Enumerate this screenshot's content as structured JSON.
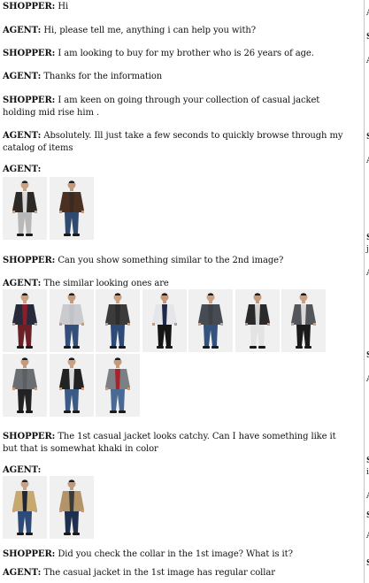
{
  "messages": [
    {
      "speaker": "SHOPPER:",
      "text": " Hi"
    },
    {
      "speaker": "AGENT:",
      "text": " Hi, please tell me, anything i can help you with?"
    },
    {
      "speaker": "SHOPPER:",
      "text": " I am looking to buy for my brother who is 26 years of age."
    },
    {
      "speaker": "AGENT:",
      "text": " Thanks for the information"
    },
    {
      "speaker": "SHOPPER:",
      "text": " I am keen on going through your collection of casual jacket holding mid rise him ."
    },
    {
      "speaker": "AGENT:",
      "text": " Absolutely. Ill just take a few seconds to quickly browse through my catalog of items"
    },
    {
      "speaker": "AGENT:",
      "text": ""
    },
    {
      "speaker": "SHOPPER:",
      "text": " Can you show something similar to the 2nd image?"
    },
    {
      "speaker": "AGENT:",
      "text": " The similar looking ones are"
    },
    {
      "speaker": "SHOPPER:",
      "text": " The 1st casual jacket looks catchy. Can I have something like it but that is somewhat khaki in color"
    },
    {
      "speaker": "AGENT:",
      "text": ""
    },
    {
      "speaker": "SHOPPER:",
      "text": " Did you check the collar in the 1st image? What is it?"
    },
    {
      "speaker": "AGENT:",
      "text": " The casual jacket in the 1st image has regular collar"
    }
  ],
  "image_sets": [
    [
      {
        "jacket": "#2d2a26",
        "inner": "#d8d8d8",
        "pants": "#b8b8b8",
        "skin": "#c9a184"
      },
      {
        "jacket": "#4a3021",
        "inner": "#3a2a22",
        "pants": "#2f4a6e",
        "skin": "#c49a7c"
      }
    ],
    [
      {
        "jacket": "#262a3a",
        "inner": "#8a1f2b",
        "pants": "#6b1f26",
        "skin": "#c9a184"
      },
      {
        "jacket": "#c9cbcf",
        "inner": "#bfc2c6",
        "pants": "#34507a",
        "skin": "#c49a7c"
      },
      {
        "jacket": "#3b3b3b",
        "inner": "#2d2d2d",
        "pants": "#2d4b78",
        "skin": "#c9a184"
      },
      {
        "jacket": "#e4e6ea",
        "inner": "#1f2a4a",
        "pants": "#151515",
        "skin": "#c49a7c"
      },
      {
        "jacket": "#474c54",
        "inner": "#3d4249",
        "pants": "#33527e",
        "skin": "#c9a184"
      },
      {
        "jacket": "#2a2a2a",
        "inner": "#d3d3d3",
        "pants": "#e3e3e3",
        "skin": "#c49a7c"
      },
      {
        "jacket": "#53565b",
        "inner": "#d9d9d9",
        "pants": "#1b1b1b",
        "skin": "#c9a184"
      },
      {
        "jacket": "#6a6d72",
        "inner": "#5c6065",
        "pants": "#222222",
        "skin": "#c49a7c"
      },
      {
        "jacket": "#222222",
        "inner": "#dcdcdc",
        "pants": "#3b5a86",
        "skin": "#c9a184"
      },
      {
        "jacket": "#7c7f84",
        "inner": "#a8222c",
        "pants": "#4a6a96",
        "skin": "#c49a7c"
      }
    ],
    [
      {
        "jacket": "#c7a86e",
        "inner": "#202634",
        "pants": "#2d4a78",
        "skin": "#c9a184"
      },
      {
        "jacket": "#b39367",
        "inner": "#3a3a3a",
        "pants": "#1f2f4e",
        "skin": "#c49a7c"
      }
    ]
  ],
  "side_panel_fragments": [
    {
      "text": "A",
      "bold": false
    },
    {
      "text": "S",
      "bold": true
    },
    {
      "text": "A",
      "bold": false
    },
    {
      "text": "S",
      "bold": true
    },
    {
      "text": "A",
      "bold": false
    },
    {
      "text": "S",
      "bold": true
    },
    {
      "text": "j",
      "bold": false
    },
    {
      "text": "A",
      "bold": false
    },
    {
      "text": "S",
      "bold": true
    },
    {
      "text": "A",
      "bold": false
    },
    {
      "text": "S",
      "bold": true
    },
    {
      "text": "i",
      "bold": false
    },
    {
      "text": "A",
      "bold": false
    },
    {
      "text": "S",
      "bold": true
    },
    {
      "text": "A",
      "bold": false
    },
    {
      "text": "S",
      "bold": true
    }
  ]
}
